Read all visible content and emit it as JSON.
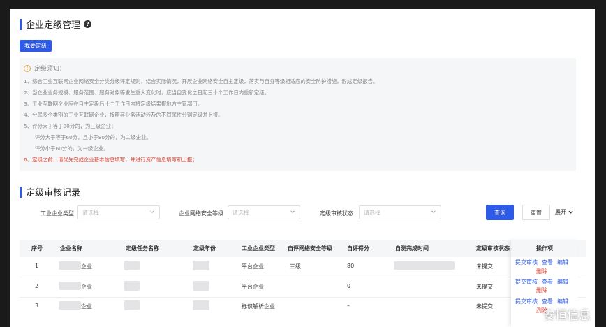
{
  "header": {
    "title": "企业定级管理",
    "help_icon": "?"
  },
  "action": {
    "grade_button": "我要定级"
  },
  "notice": {
    "title": "定级须知：",
    "lines": [
      "1、综合工业互联网企业网络安全分类分级评定规则，结合实际情况，开展企业网络安全自主定级，落实与自身等级相适应的安全防护措施，形成定级报告。",
      "2、当企业业务规模、服务范围、服务对象等发生重大变化时，应当自变化之日起三十个工作日内重新定级。",
      "3、工业互联网企业应在自主定级后十个工作日内将定级结果报地方主管部门。",
      "4、分属多个类别的工业互联网企业，按照其业务活动涉及的不同属性分别定级并上报。",
      "5、评分大于等于80分的，为三级企业；",
      "评分大于等于60分，且小于80分的，为二级企业。",
      "评分小于60分的，为一级企业。",
      "6、定级之前，请优先完成企业基本信息填写，并进行资产信息填写和上报；"
    ]
  },
  "records": {
    "title": "定级审核记录"
  },
  "filters": {
    "type_label": "工业企业类型",
    "type_placeholder": "请选择",
    "level_label": "企业网络安全等级",
    "level_placeholder": "请选择",
    "status_label": "定级审核状态",
    "status_placeholder": "请选择",
    "query_button": "查询",
    "reset_button": "重置",
    "expand_label": "展开"
  },
  "table": {
    "headers": [
      "序号",
      "企业名称",
      "定级任务名称",
      "定级年份",
      "工业企业类型",
      "自评网络安全等级",
      "自评得分",
      "自测完成时间",
      "定级审核状态",
      "操作项"
    ],
    "rows": [
      {
        "index": "1",
        "name_suffix": "企业",
        "type": "平台企业",
        "level": "三级",
        "score": "80",
        "status": "未提交"
      },
      {
        "index": "2",
        "name_suffix": "企业",
        "type": "平台企业",
        "level": "",
        "score": "0",
        "status": "未提交"
      },
      {
        "index": "3",
        "name_suffix": "企业",
        "type": "标识解析企业",
        "level": "",
        "score": "–",
        "status": "未提交"
      }
    ],
    "ops": {
      "submit": "提交审核",
      "view": "查看",
      "edit": "编辑",
      "delete": "删除"
    }
  },
  "watermark": {
    "text": "安恒信息"
  }
}
